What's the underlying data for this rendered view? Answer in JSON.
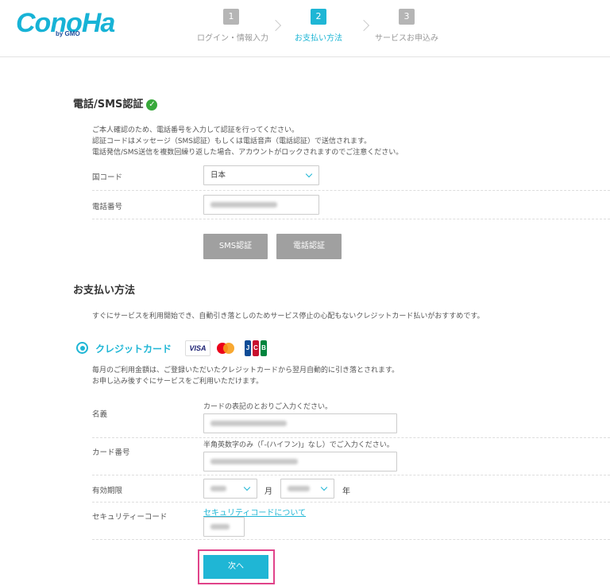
{
  "header": {
    "logo_main": "ConoHa",
    "logo_sub": "by GMO",
    "steps": [
      {
        "num": "1",
        "label": "ログイン・情報入力"
      },
      {
        "num": "2",
        "label": "お支払い方法"
      },
      {
        "num": "3",
        "label": "サービスお申込み"
      }
    ]
  },
  "phone_section": {
    "title": "電話/SMS認証",
    "notes": [
      "ご本人確認のため、電話番号を入力して認証を行ってください。",
      "認証コードはメッセージ（SMS認証）もしくは電話音声（電話認証）で送信されます。",
      "電話発信/SMS送信を複数回繰り返した場合、アカウントがロックされますのでご注意ください。"
    ],
    "country_label": "国コード",
    "country_value": "日本",
    "phone_label": "電話番号",
    "sms_button": "SMS認証",
    "tel_button": "電話認証"
  },
  "payment_section": {
    "title": "お支払い方法",
    "intro": "すぐにサービスを利用開始でき、自動引き落としのためサービス停止の心配もないクレジットカード払いがおすすめです。",
    "credit_label": "クレジットカード",
    "cards": {
      "visa": "VISA",
      "jcb": [
        "J",
        "C",
        "B"
      ]
    },
    "card_notes": [
      "毎月のご利用金額は、ご登録いただいたクレジットカードから翌月自動的に引き落とされます。",
      "お申し込み後すぐにサービスをご利用いただけます。"
    ],
    "name_label": "名義",
    "name_hint": "カードの表記のとおりご入力ください。",
    "number_label": "カード番号",
    "number_hint": "半角英数字のみ（「-(ハイフン)」なし）でご入力ください。",
    "expiry_label": "有効期限",
    "month_unit": "月",
    "year_unit": "年",
    "cvc_label": "セキュリティーコード",
    "cvc_link": "セキュリティコードについて",
    "next_button": "次へ"
  },
  "colors": {
    "accent": "#1fb6d5",
    "highlight": "#e0438a",
    "verified": "#38a93b",
    "button_gray": "#a0a0a0"
  }
}
